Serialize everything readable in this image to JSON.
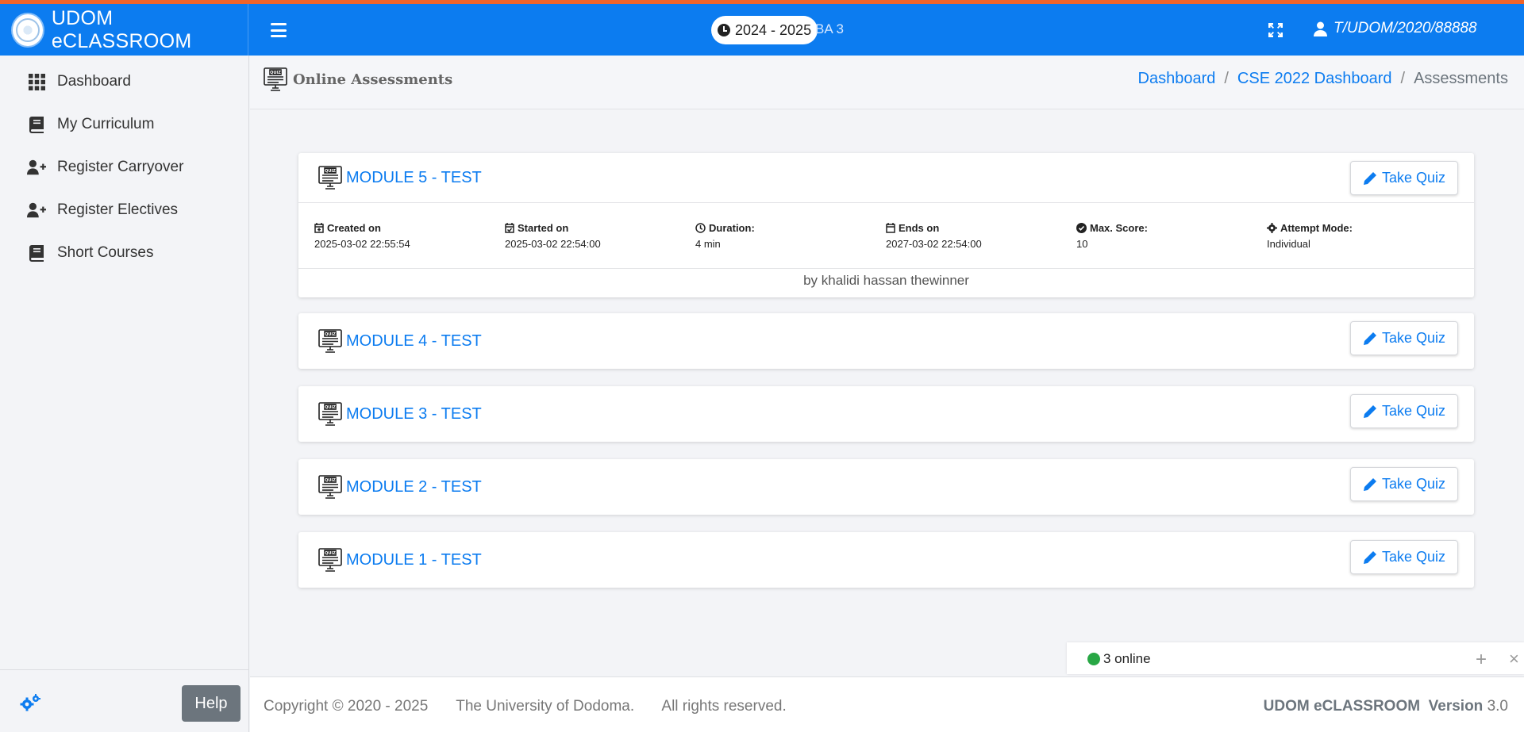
{
  "app": {
    "brand": "UDOM eCLASSROOM",
    "academic_year": "2024 - 2025",
    "level": "BA 3",
    "user_id": "T/UDOM/2020/88888"
  },
  "colors": {
    "primary": "#0c7cf0",
    "accent_stripe": "#f0642a",
    "success": "#28a745",
    "help_button": "#6c757d"
  },
  "sidebar": {
    "items": [
      {
        "label": "Dashboard",
        "icon": "grid-icon"
      },
      {
        "label": "My Curriculum",
        "icon": "book-icon"
      },
      {
        "label": "Register Carryover",
        "icon": "user-plus-icon"
      },
      {
        "label": "Register Electives",
        "icon": "user-plus-icon"
      },
      {
        "label": "Short Courses",
        "icon": "book-icon"
      }
    ],
    "help_label": "Help"
  },
  "header": {
    "title": "Online Assessments",
    "breadcrumb": {
      "home": "Dashboard",
      "course": "CSE 2022 Dashboard",
      "current": "Assessments",
      "sep": "/"
    }
  },
  "quizzes": [
    {
      "title": "MODULE 5 - TEST",
      "button": "Take Quiz",
      "details": {
        "created_label": "Created on",
        "created": "2025-03-02 22:55:54",
        "started_label": "Started on",
        "started": "2025-03-02 22:54:00",
        "duration_label": "Duration:",
        "duration": "4 min",
        "ends_label": "Ends on",
        "ends": "2027-03-02 22:54:00",
        "score_label": "Max. Score:",
        "score": "10",
        "mode_label": "Attempt Mode:",
        "mode": "Individual"
      },
      "author": "by khalidi hassan thewinner"
    },
    {
      "title": "MODULE 4 - TEST",
      "button": "Take Quiz"
    },
    {
      "title": "MODULE 3 - TEST",
      "button": "Take Quiz"
    },
    {
      "title": "MODULE 2 - TEST",
      "button": "Take Quiz"
    },
    {
      "title": "MODULE 1 - TEST",
      "button": "Take Quiz"
    }
  ],
  "online": {
    "text": "3 online",
    "plus": "+",
    "close": "×"
  },
  "footer": {
    "copyright": "Copyright © 2020 - 2025",
    "org": "The University of Dodoma.",
    "rights": "All rights reserved.",
    "product": "UDOM eCLASSROOM",
    "version_label": "Version",
    "version": "3.0"
  }
}
